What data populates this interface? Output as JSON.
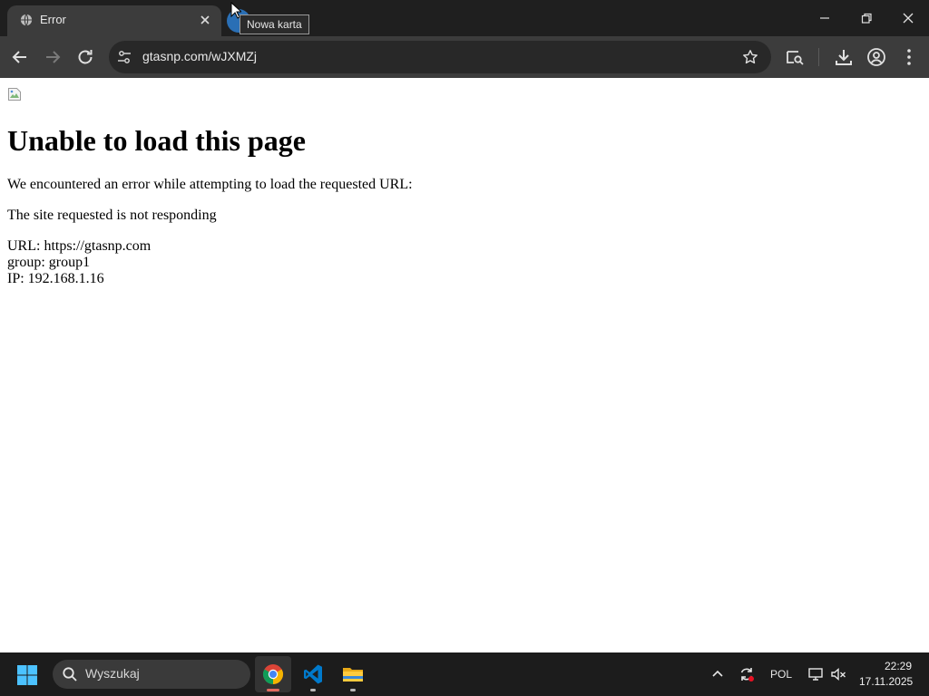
{
  "browser": {
    "tab": {
      "title": "Error",
      "favicon": "globe-icon"
    },
    "new_tab_tooltip": "Nowa karta",
    "address_bar": {
      "url": "gtasnp.com/wJXMZj"
    },
    "icons": {
      "back": "arrow-left-icon",
      "forward": "arrow-right-icon",
      "reload": "reload-icon",
      "site_info": "tune-icon",
      "bookmark": "star-icon",
      "search_tabs": "tab-search-icon",
      "downloads": "download-icon",
      "profile": "profile-icon",
      "menu": "kebab-menu-icon"
    },
    "colors": {
      "tab_bar": "#1f1f1f",
      "toolbar": "#3c3c3c",
      "omnibox": "#282828"
    }
  },
  "page": {
    "heading": "Unable to load this page",
    "paragraph_1": "We encountered an error while attempting to load the requested URL:",
    "paragraph_2": "The site requested is not responding",
    "details": [
      "URL: https://gtasnp.com",
      "group: group1",
      "IP: 192.168.1.16"
    ]
  },
  "taskbar": {
    "search_placeholder": "Wyszukaj",
    "apps": [
      {
        "name": "Google Chrome",
        "icon": "chrome-icon",
        "active": true
      },
      {
        "name": "Visual Studio Code",
        "icon": "vscode-icon",
        "active": false
      },
      {
        "name": "File Explorer",
        "icon": "folder-icon",
        "active": false
      }
    ],
    "tray": {
      "language": "POL",
      "time": "22:29",
      "date": "17.11.2025"
    }
  }
}
